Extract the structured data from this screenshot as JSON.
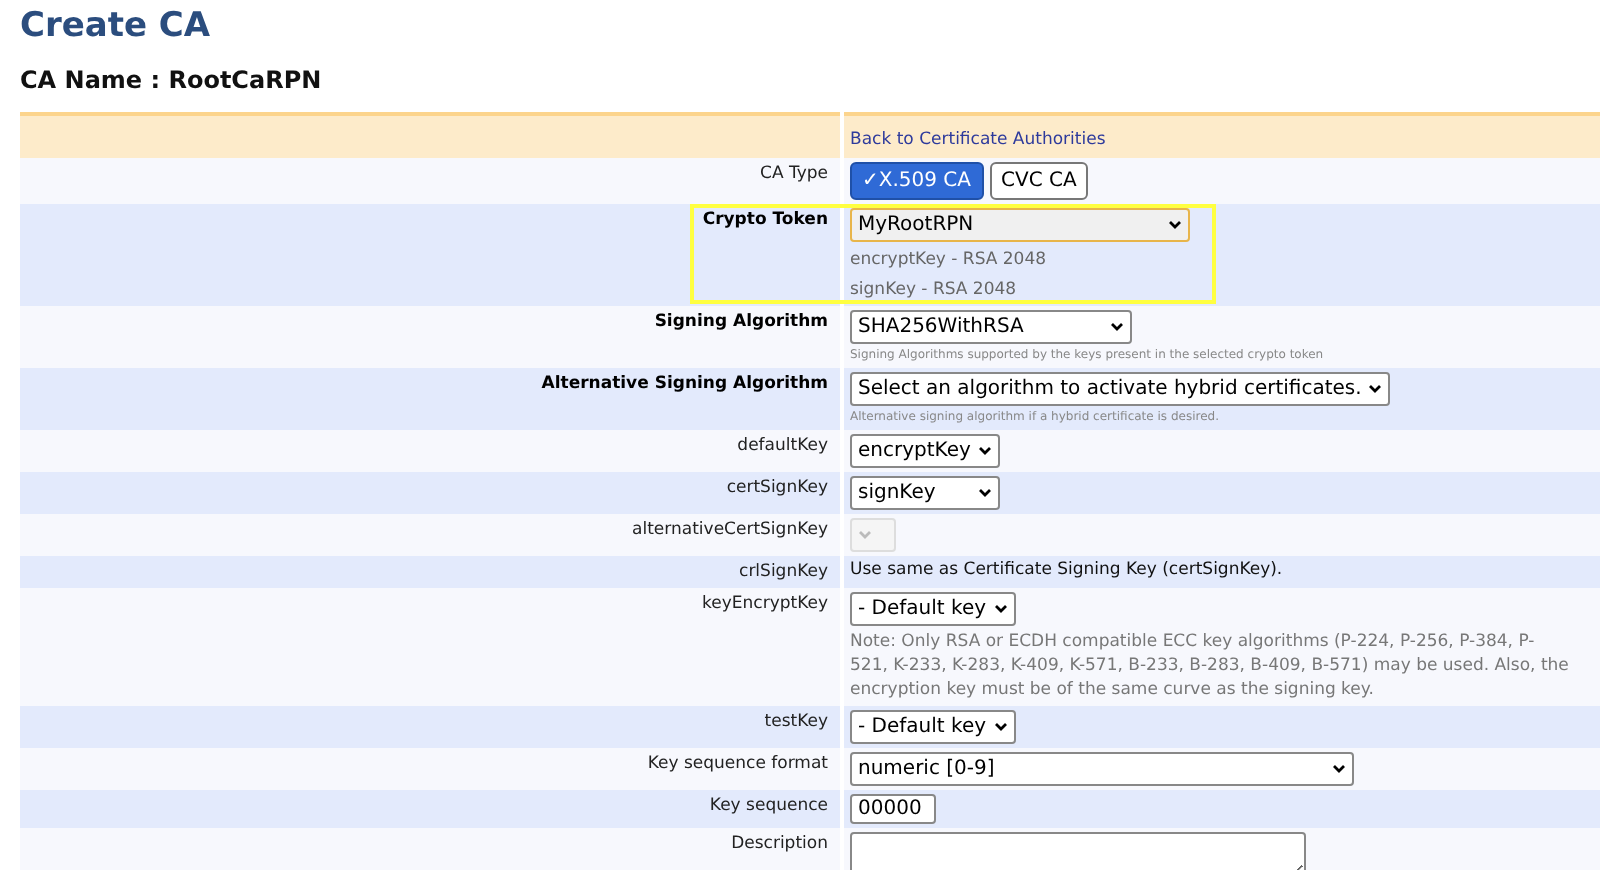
{
  "title": "Create CA",
  "ca_name": "CA Name : RootCaRPN",
  "back_link": "Back to Certificate Authorities",
  "rows": [
    {
      "label": "CA Type",
      "label_bold": false,
      "kind": "buttons",
      "options": [
        {
          "label": "✓X.509 CA",
          "selected": true
        },
        {
          "label": "CVC CA",
          "selected": false
        }
      ]
    },
    {
      "label": "Crypto Token",
      "label_bold": true,
      "highlighted": true,
      "kind": "select",
      "value": "MyRootRPN",
      "lines": [
        "encryptKey - RSA 2048",
        "signKey - RSA 2048"
      ]
    },
    {
      "label": "Signing Algorithm",
      "label_bold": true,
      "kind": "select",
      "value": "SHA256WithRSA",
      "hint": "Signing Algorithms supported by the keys present in the selected crypto token"
    },
    {
      "label": "Alternative Signing Algorithm",
      "label_bold": true,
      "kind": "select",
      "value": "Select an algorithm to activate hybrid certificates.",
      "hint": "Alternative signing algorithm if a hybrid certificate is desired."
    },
    {
      "label": "defaultKey",
      "label_bold": false,
      "kind": "select",
      "value": "encryptKey"
    },
    {
      "label": "certSignKey",
      "label_bold": false,
      "kind": "select",
      "value": "signKey"
    },
    {
      "label": "alternativeCertSignKey",
      "label_bold": false,
      "kind": "select",
      "disabled": true
    },
    {
      "label": "crlSignKey",
      "label_bold": false,
      "kind": "text",
      "text": "Use same as Certificate Signing Key (certSignKey)."
    },
    {
      "label": "keyEncryptKey",
      "label_bold": false,
      "kind": "select",
      "value": "- Default key",
      "note": "Note: Only RSA or ECDH compatible ECC key algorithms (P-224, P-256, P-384, P-521, K-233, K-283, K-409, K-571, B-233, B-283, B-409, B-571) may be used. Also, the encryption key must be of the same curve as the signing key."
    },
    {
      "label": "testKey",
      "label_bold": false,
      "kind": "select",
      "value": "- Default key"
    },
    {
      "label": "Key sequence format",
      "label_bold": false,
      "kind": "select",
      "value": "numeric [0-9]"
    },
    {
      "label": "Key sequence",
      "label_bold": false,
      "kind": "input",
      "value": "00000"
    },
    {
      "label": "Description",
      "label_bold": false,
      "kind": "textarea"
    }
  ]
}
